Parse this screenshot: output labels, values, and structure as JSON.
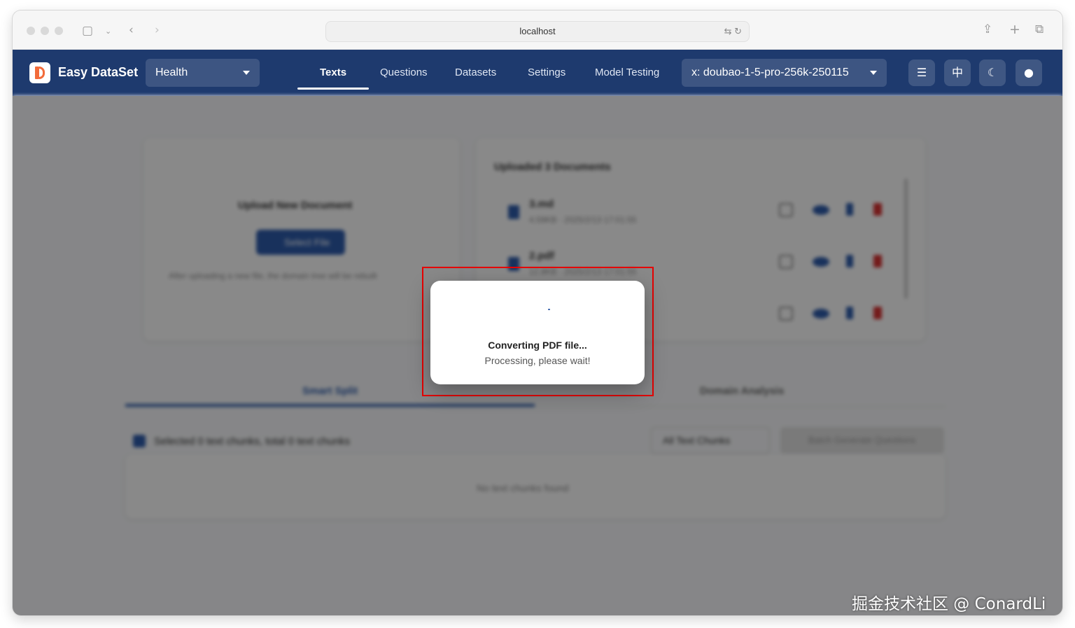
{
  "browser": {
    "url": "localhost"
  },
  "app": {
    "brand": "Easy DataSet",
    "project_select": "Health",
    "nav": [
      "Texts",
      "Questions",
      "Datasets",
      "Settings",
      "Model Testing"
    ],
    "model_select": "x: doubao-1-5-pro-256k-250115",
    "lang_button": "中"
  },
  "background": {
    "upload_title": "Upload New Document",
    "select_file": "Select File",
    "upload_hint": "After uploading a new file, the domain tree will be rebuilt",
    "uploaded_title": "Uploaded 3 Documents",
    "files": [
      {
        "name": "3.md",
        "meta": "4.59KB · 2025/2/13 17:01:55"
      },
      {
        "name": "2.pdf",
        "meta": "12.8KB · 2025/2/13 17:01:55"
      },
      {
        "name": "",
        "meta": ""
      }
    ],
    "tabs": [
      "Smart Split",
      "Domain Analysis"
    ],
    "selection_text": "Selected 0 text chunks, total 0 text chunks",
    "filter": "All Text Chunks",
    "generate_button": "Batch Generate Questions",
    "empty_text": "No text chunks found"
  },
  "modal": {
    "title": "Converting PDF file...",
    "subtitle": "Processing, please wait!"
  },
  "watermark": "掘金技术社区 @ ConardLi"
}
